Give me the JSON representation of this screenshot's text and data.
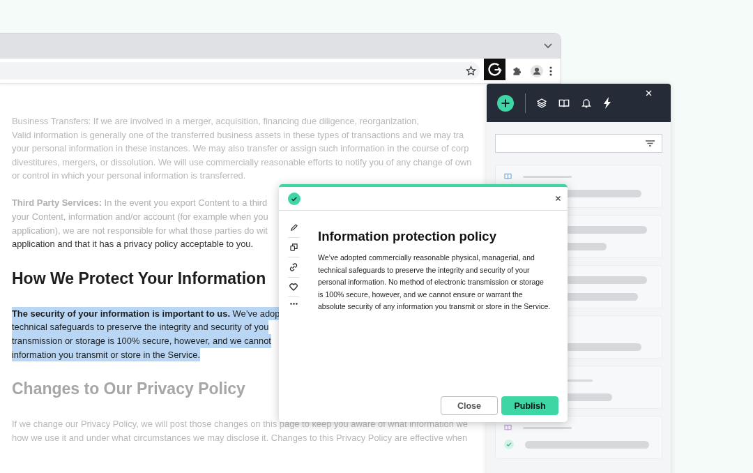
{
  "browser": {
    "page": {
      "blocks": [
        {
          "kind": "paragraph",
          "selected": false,
          "lines": [
            "Business Transfers: If we are involved in a merger, acquisition, financing due diligence, reorganization,",
            "Valid information is generally one of the transferred business assets in these types of transactions and we may tra",
            "your personal information in these instances. We may also transfer or assign such information in the course of corp",
            "divestitures, mergers, or dissolution. We will use commercially reasonable efforts to notify you of any change of own",
            "or control in which your personal information is transferred."
          ]
        },
        {
          "kind": "paragraph",
          "selected": false,
          "lines": [
            "**Third Party Services:** In the event you export Content to a third",
            "your Content, information and/or account (for example when you",
            "application), we are not responsible for what those parties do wit",
            "application and that it has a privacy policy acceptable to you."
          ]
        },
        {
          "kind": "heading",
          "text": "How We Protect Your Information"
        },
        {
          "kind": "paragraph",
          "selected": true,
          "lines": [
            "**The security of your information is important to us.** We’ve adop",
            "technical safeguards to preserve the integrity and security of you",
            "transmission or storage is 100% secure, however, and we cannot",
            "information you transmit or store in the Service."
          ]
        },
        {
          "kind": "heading",
          "text": "Changes to Our Privacy Policy"
        },
        {
          "kind": "paragraph",
          "selected": false,
          "lines": [
            "If we change our Privacy Policy, we will post those changes on this page to keep you aware of what information we",
            "how we use it and under what circumstances we may disclose it. Changes to this Privacy Policy are effective when"
          ]
        }
      ]
    }
  },
  "popup": {
    "complete": true,
    "title": "Information protection policy",
    "body": "We’ve adopted commercially reasonable physical, managerial, and technical safeguards to preserve the integrity and security of your personal information. No method of electronic transmission or storage is 100% secure, however, and we cannot ensure or warrant the absolute security of any information you transmit or store in the Service.",
    "buttons": [
      {
        "label": "Close",
        "kind": "secondary"
      },
      {
        "label": "Publish",
        "kind": "primary"
      }
    ]
  }
}
